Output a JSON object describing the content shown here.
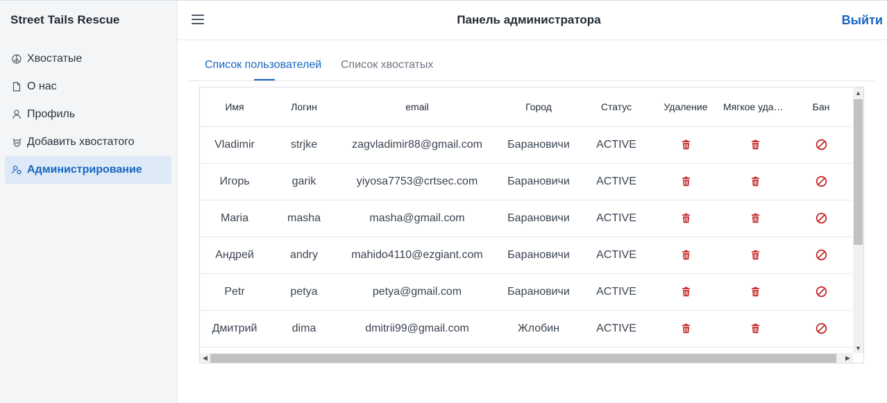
{
  "app": {
    "brand": "Street Tails Rescue"
  },
  "sidebar": {
    "items": [
      {
        "label": "Хвостатые",
        "icon": "paw-icon",
        "active": false
      },
      {
        "label": "О нас",
        "icon": "document-icon",
        "active": false
      },
      {
        "label": "Профиль",
        "icon": "user-icon",
        "active": false
      },
      {
        "label": "Добавить хвостатого",
        "icon": "add-pet-icon",
        "active": false
      },
      {
        "label": "Администрирование",
        "icon": "users-admin-icon",
        "active": true
      }
    ]
  },
  "header": {
    "title": "Панель администратора",
    "logout_label": "Выйти",
    "menu_icon": "hamburger-menu-icon"
  },
  "tabs": [
    {
      "label": "Список пользователей",
      "active": true
    },
    {
      "label": "Список хвостатых",
      "active": false
    }
  ],
  "table": {
    "columns": [
      "Имя",
      "Логин",
      "email",
      "Город",
      "Статус",
      "Удаление",
      "Мягкое удаление",
      "Бан"
    ],
    "rows": [
      {
        "name": "Vladimir",
        "login": "strjke",
        "email": "zagvladimir88@gmail.com",
        "city": "Барановичи",
        "status": "ACTIVE"
      },
      {
        "name": "Игорь",
        "login": "garik",
        "email": "yiyosa7753@crtsec.com",
        "city": "Барановичи",
        "status": "ACTIVE"
      },
      {
        "name": "Maria",
        "login": "masha",
        "email": "masha@gmail.com",
        "city": "Барановичи",
        "status": "ACTIVE"
      },
      {
        "name": "Андрей",
        "login": "andry",
        "email": "mahido4110@ezgiant.com",
        "city": "Барановичи",
        "status": "ACTIVE"
      },
      {
        "name": "Petr",
        "login": "petya",
        "email": "petya@gmail.com",
        "city": "Барановичи",
        "status": "ACTIVE"
      },
      {
        "name": "Дмитрий",
        "login": "dima",
        "email": "dmitrii99@gmail.com",
        "city": "Жлобин",
        "status": "ACTIVE"
      }
    ],
    "action_icons": {
      "delete": "trash-icon",
      "soft_delete": "trash-icon",
      "ban": "ban-icon"
    }
  },
  "colors": {
    "accent": "#1565c0",
    "active_nav_bg": "#dde9f7",
    "danger": "#c62828",
    "sidebar_bg": "#f3f5f7"
  }
}
